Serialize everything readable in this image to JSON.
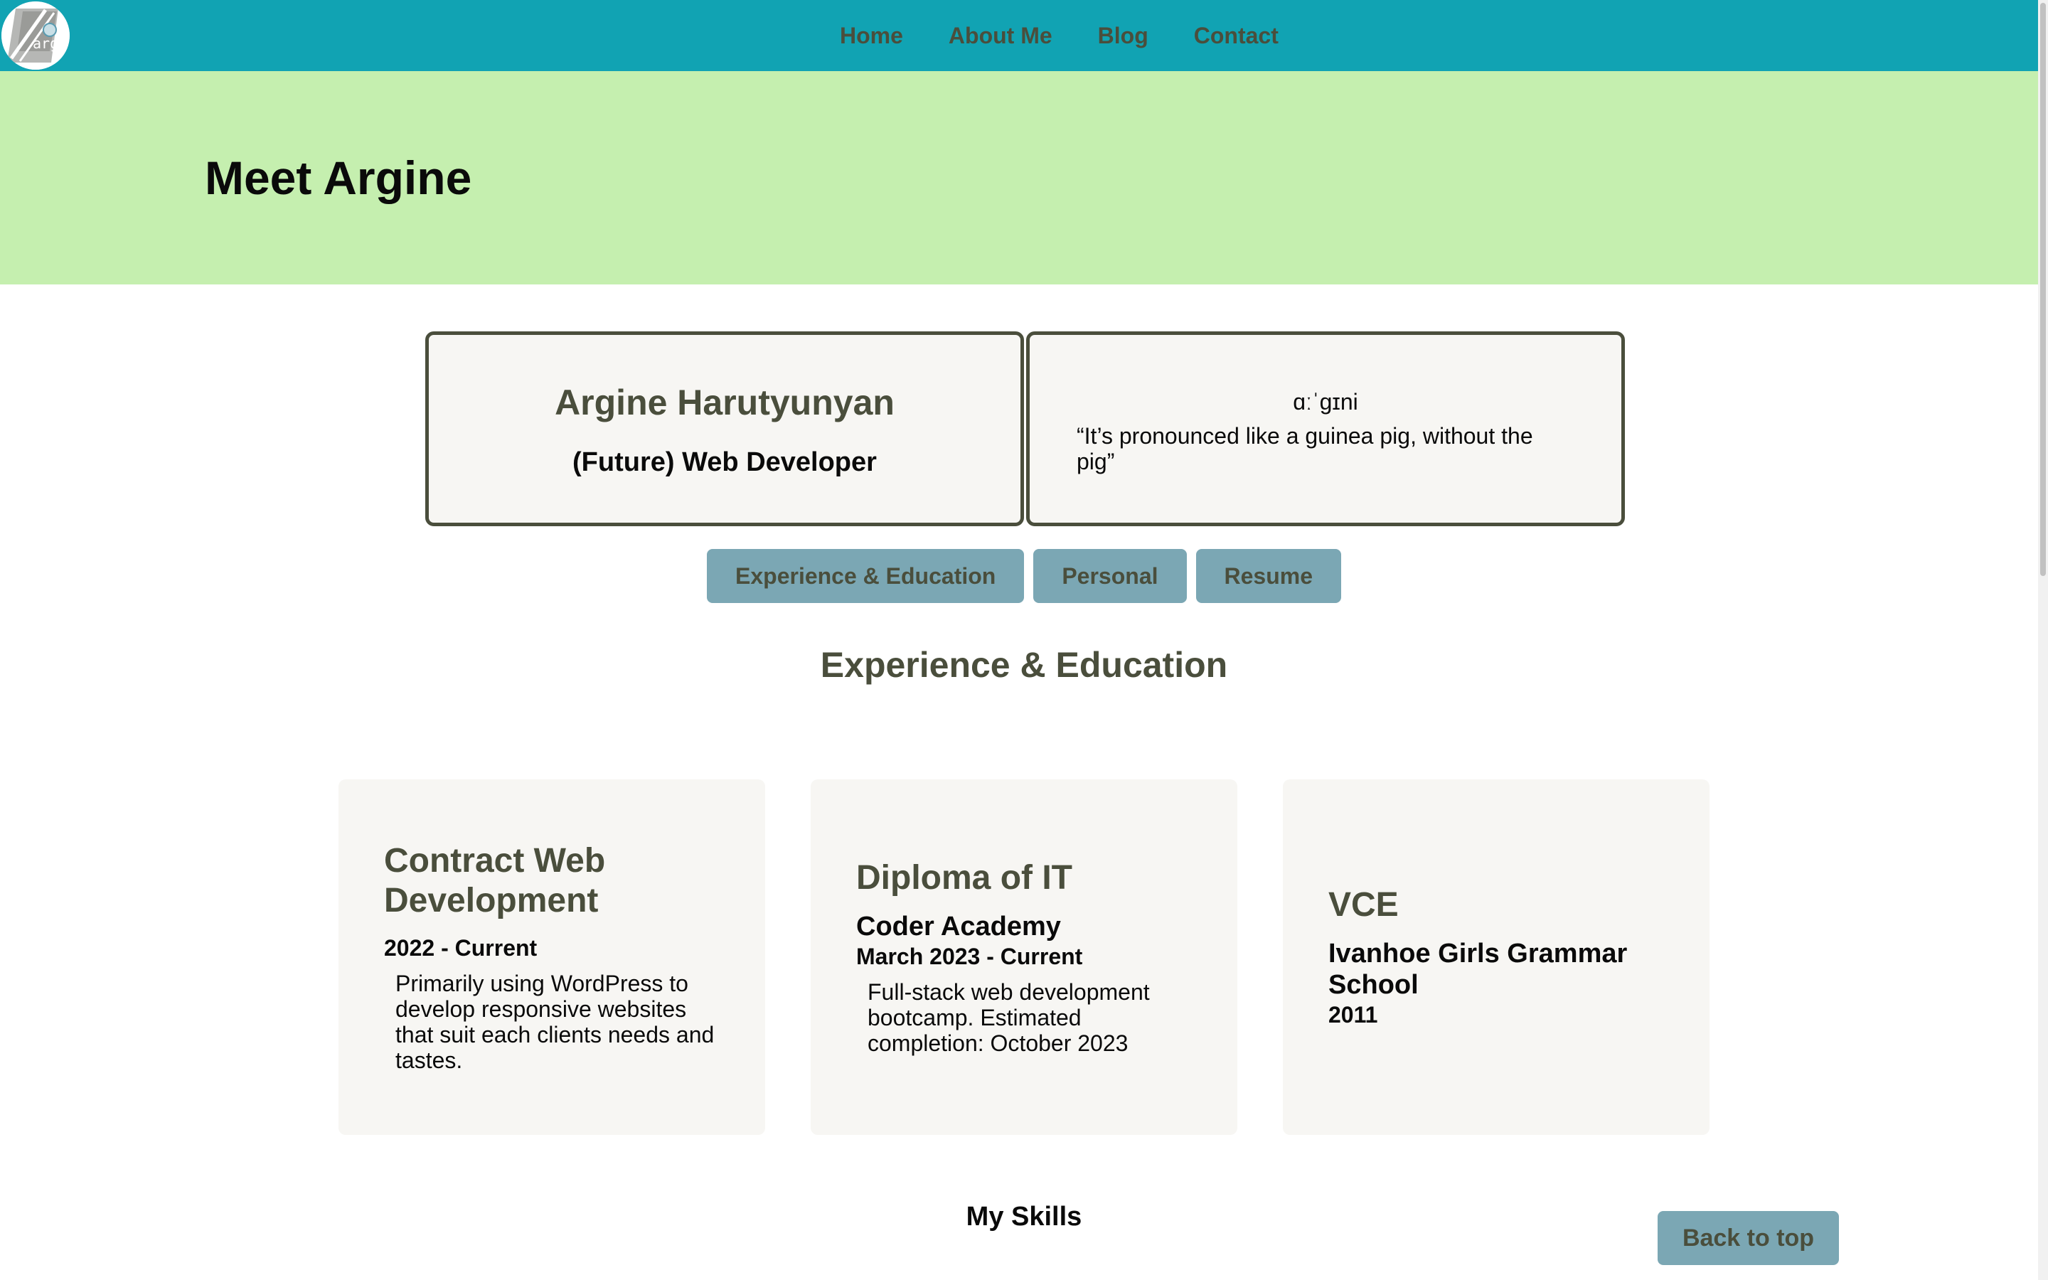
{
  "nav": {
    "logo_text": "arg",
    "links": [
      "Home",
      "About Me",
      "Blog",
      "Contact"
    ]
  },
  "hero": {
    "title": "Meet Argine"
  },
  "intro": {
    "name": "Argine Harutyunyan",
    "role": "(Future) Web Developer",
    "pronunciation": "ɑːˈɡɪni",
    "quote": "“It’s pronounced like a guinea pig, without the pig”"
  },
  "tabs": [
    "Experience & Education",
    "Personal",
    "Resume"
  ],
  "section": {
    "title": "Experience & Education"
  },
  "experience": [
    {
      "title": "Contract Web Development",
      "org": "",
      "date": "2022 - Current",
      "description": "Primarily using WordPress to develop responsive websites that suit each clients needs and tastes."
    },
    {
      "title": "Diploma of IT",
      "org": "Coder Academy",
      "date": "March 2023 - Current",
      "description": "Full-stack web development bootcamp. Estimated completion: October 2023"
    },
    {
      "title": "VCE",
      "org": "Ivanhoe Girls Grammar School",
      "date": "2011",
      "description": ""
    }
  ],
  "skills": {
    "title": "My Skills"
  },
  "back_to_top": "Back to top",
  "colors": {
    "navbar": "#11a3b3",
    "hero": "#c5efaf",
    "button": "#7ba7b4",
    "text_dark": "#4a4e3c",
    "card_bg": "#f7f6f3"
  }
}
